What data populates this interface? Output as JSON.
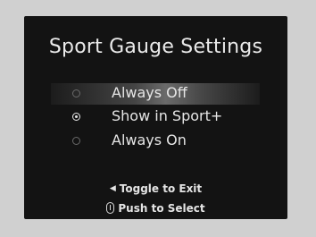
{
  "screen": {
    "title": "Sport Gauge Settings",
    "options": [
      {
        "label": "Always Off",
        "highlighted": true,
        "checked": false
      },
      {
        "label": "Show in Sport+",
        "highlighted": false,
        "checked": true
      },
      {
        "label": "Always On",
        "highlighted": false,
        "checked": false
      }
    ],
    "hints": {
      "exit": "Toggle to Exit",
      "select": "Push to Select"
    }
  },
  "colors": {
    "background": "#d0d0d0",
    "screen": "#131313",
    "text": "#e6e6e6"
  }
}
